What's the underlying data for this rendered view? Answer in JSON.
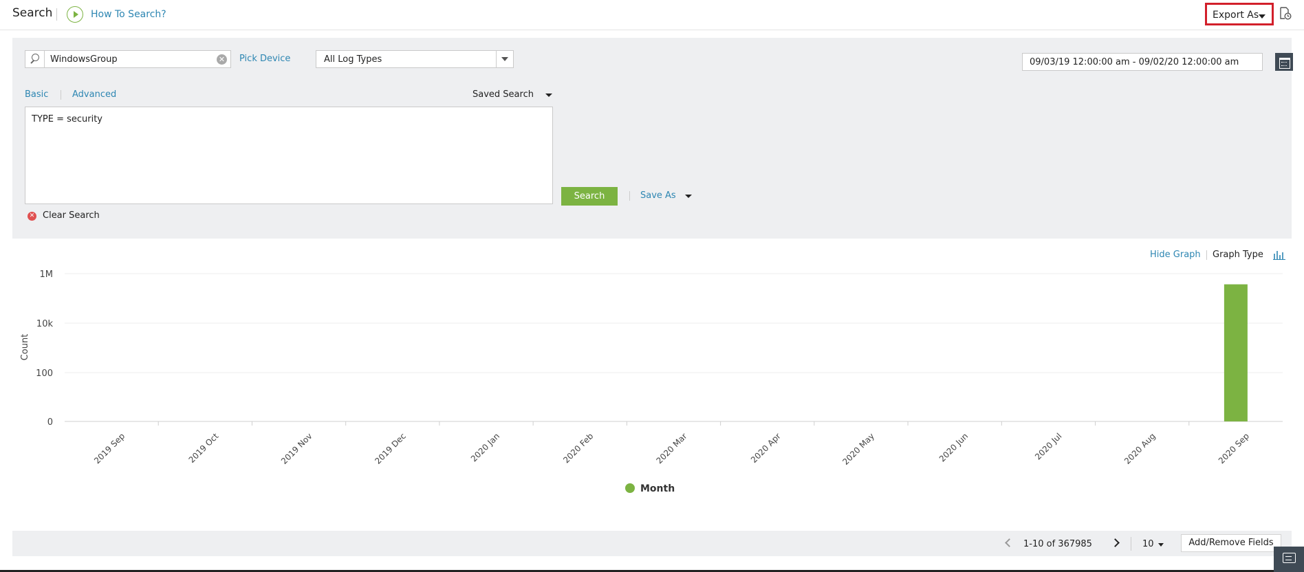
{
  "header": {
    "title": "Search",
    "how_to": "How To Search?",
    "export_label": "Export As"
  },
  "search": {
    "device_value": "WindowsGroup",
    "pick_device": "Pick Device",
    "log_type": "All Log Types",
    "date_range": "09/03/19 12:00:00 am - 09/02/20 12:00:00 am",
    "tab_basic": "Basic",
    "tab_advanced": "Advanced",
    "saved_search": "Saved Search",
    "query": "TYPE = security",
    "search_button": "Search",
    "save_as": "Save As",
    "clear_search": "Clear Search"
  },
  "graph_controls": {
    "hide_graph": "Hide Graph",
    "graph_type": "Graph Type"
  },
  "chart_data": {
    "type": "bar",
    "title": "",
    "xlabel": "",
    "ylabel": "Count",
    "y_scale": "log",
    "y_ticks": [
      "1M",
      "10k",
      "100",
      "0"
    ],
    "categories": [
      "2019 Sep",
      "2019 Oct",
      "2019 Nov",
      "2019 Dec",
      "2020 Jan",
      "2020 Feb",
      "2020 Mar",
      "2020 Apr",
      "2020 May",
      "2020 Jun",
      "2020 Jul",
      "2020 Aug",
      "2020 Sep"
    ],
    "series": [
      {
        "name": "Month",
        "color": "#7cb342",
        "values": [
          0,
          0,
          0,
          0,
          0,
          0,
          0,
          0,
          0,
          0,
          0,
          0,
          367985
        ]
      }
    ],
    "legend_position": "bottom-center",
    "grid": true
  },
  "footer": {
    "page_info": "1-10 of 367985",
    "per_page": "10",
    "add_remove": "Add/Remove Fields"
  },
  "colors": {
    "accent": "#2d86b2",
    "bar": "#7cb342",
    "highlight": "#d21f2a"
  }
}
